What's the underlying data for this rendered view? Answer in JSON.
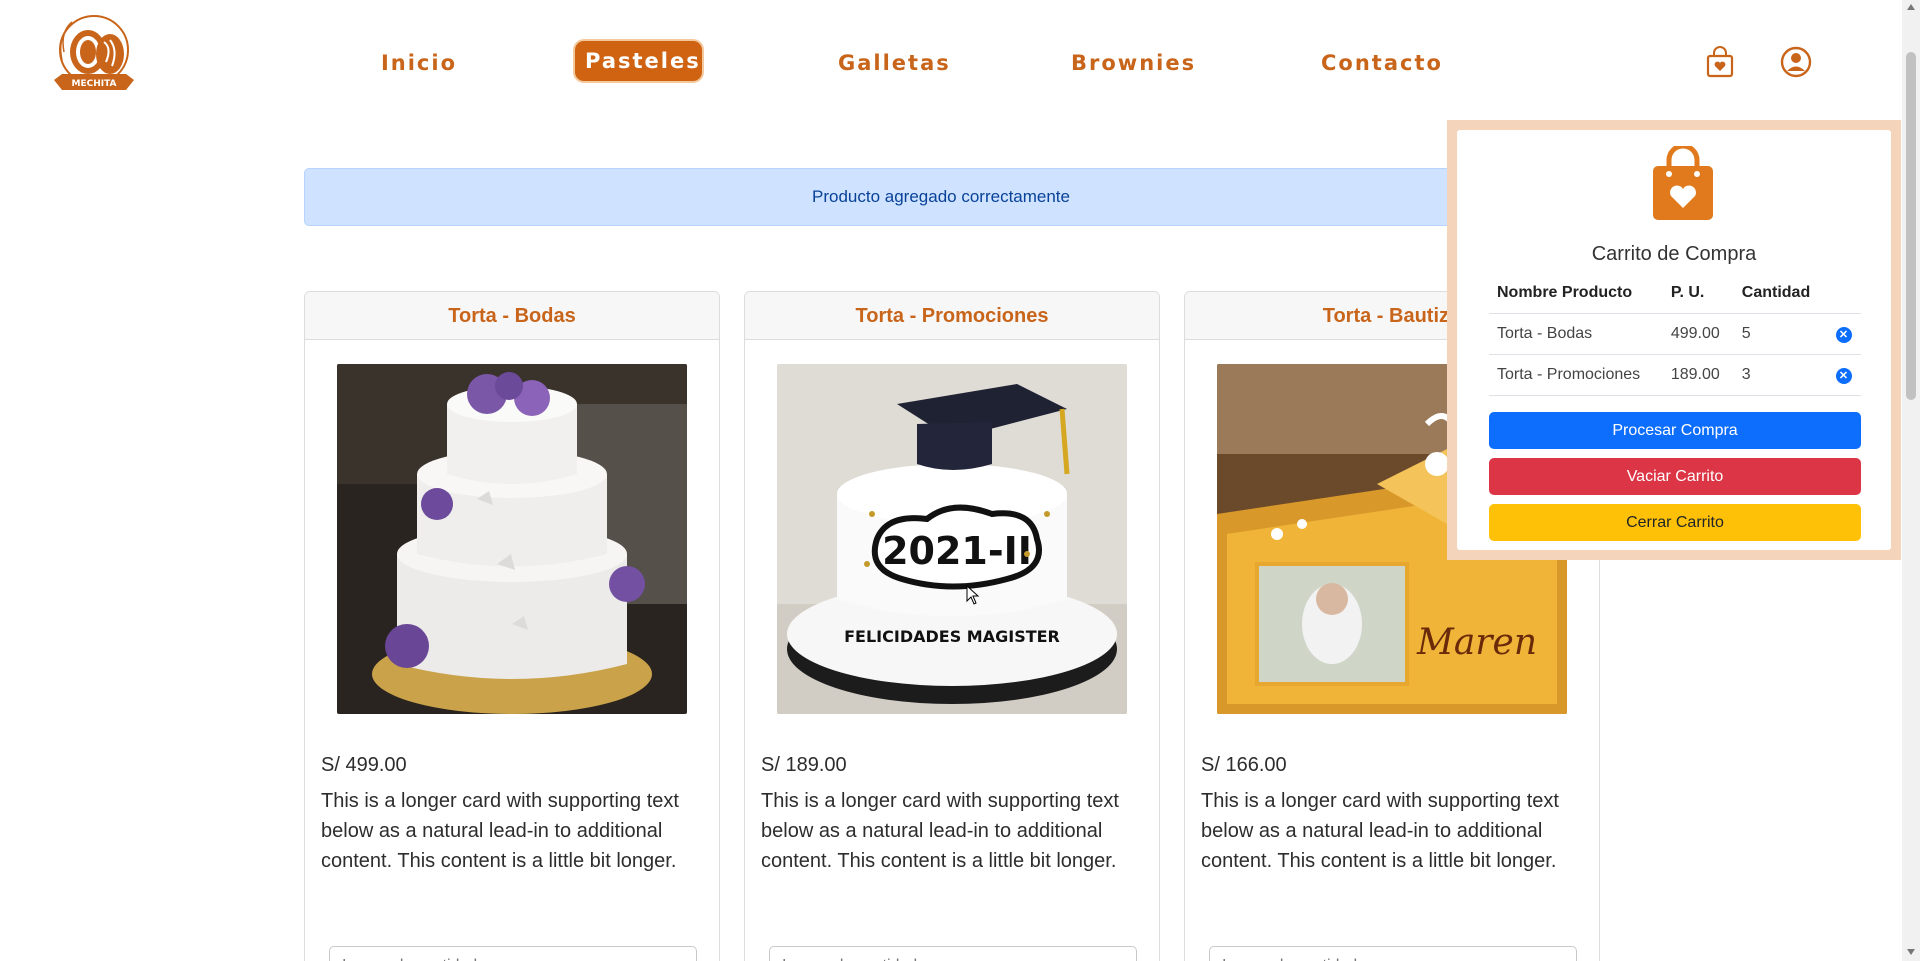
{
  "brand": {
    "logo_text": "MECHITA"
  },
  "nav": {
    "items": [
      {
        "label": "Inicio",
        "active": false
      },
      {
        "label": "Pasteles",
        "active": true
      },
      {
        "label": "Galletas",
        "active": false
      },
      {
        "label": "Brownies",
        "active": false
      },
      {
        "label": "Contacto",
        "active": false
      }
    ],
    "cart_icon": "shopping-bag-icon",
    "user_icon": "user-circle-icon"
  },
  "alert": {
    "message": "Producto agregado correctamente"
  },
  "products": [
    {
      "title": "Torta - Bodas",
      "price": "S/ 499.00",
      "description": "This is a longer card with supporting text below as a natural lead-in to additional content. This content is a little bit longer.",
      "quantity_placeholder": "Ingrese la cantidad a comprar",
      "image": "wedding-cake-photo"
    },
    {
      "title": "Torta - Promociones",
      "price": "S/ 189.00",
      "description": "This is a longer card with supporting text below as a natural lead-in to additional content. This content is a little bit longer.",
      "quantity_placeholder": "Ingrese la cantidad a comprar",
      "image": "graduation-cake-photo",
      "image_text": "2021-II",
      "image_subtext": "FELICIDADES  MAGISTER"
    },
    {
      "title": "Torta - Bautizo",
      "price": "S/ 166.00",
      "description": "This is a longer card with supporting text below as a natural lead-in to additional content. This content is a little bit longer.",
      "quantity_placeholder": "Ingrese la cantidad a comprar",
      "image": "baptism-cake-photo",
      "image_text": "Maren"
    }
  ],
  "cart": {
    "title": "Carrito de Compra",
    "columns": [
      "Nombre Producto",
      "P. U.",
      "Cantidad"
    ],
    "rows": [
      {
        "name": "Torta - Bodas",
        "unit_price": "499.00",
        "quantity": "5"
      },
      {
        "name": "Torta - Promociones",
        "unit_price": "189.00",
        "quantity": "3"
      }
    ],
    "buttons": {
      "process": "Procesar Compra",
      "empty": "Vaciar Carrito",
      "close": "Cerrar Carrito"
    }
  },
  "colors": {
    "brand": "#c8651a",
    "active_nav_bg": "#cf6312",
    "alert_bg": "#cfe2ff",
    "cart_border": "#f4d5bc",
    "primary": "#0d6efd",
    "danger": "#dc3545",
    "warning": "#ffc107"
  }
}
